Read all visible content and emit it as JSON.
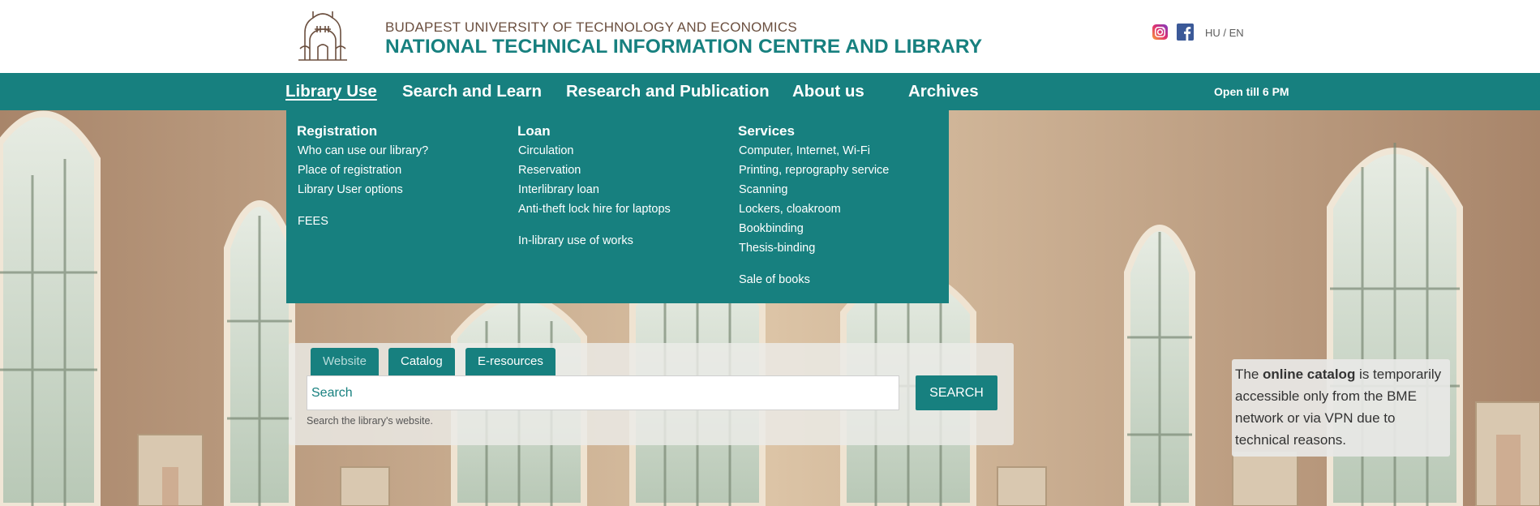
{
  "header": {
    "university": "BUDAPEST UNIVERSITY OF TECHNOLOGY AND ECONOMICS",
    "library": "NATIONAL TECHNICAL INFORMATION CENTRE AND LIBRARY",
    "social": [
      "instagram-icon",
      "facebook-icon"
    ],
    "lang": "HU / EN"
  },
  "nav": {
    "items": [
      {
        "label": "Library Use",
        "active": true
      },
      {
        "label": "Search and Learn"
      },
      {
        "label": "Research and Publication"
      },
      {
        "label": "About us"
      },
      {
        "label": "Archives"
      }
    ],
    "open_hours": "Open till 6 PM"
  },
  "mega_menu": {
    "columns": [
      {
        "heading": "Registration",
        "links": [
          "Who can use our library?",
          "Place of registration",
          "Library User options"
        ],
        "extra": [
          "FEES"
        ]
      },
      {
        "heading": "Loan",
        "links": [
          "Circulation",
          "Reservation",
          "Interlibrary loan",
          "Anti-theft lock hire for laptops"
        ],
        "extra": [
          "In-library use of works"
        ]
      },
      {
        "heading": "Services",
        "links": [
          "Computer, Internet, Wi-Fi",
          "Printing, reprography service",
          "Scanning",
          "Lockers, cloakroom",
          "Bookbinding",
          "Thesis-binding"
        ],
        "extra": [
          "Sale of books"
        ]
      }
    ]
  },
  "search": {
    "tabs": [
      "Website",
      "Catalog",
      "E-resources"
    ],
    "active_tab": "Website",
    "placeholder": "Search",
    "button": "SEARCH",
    "hint": "Search the library's website."
  },
  "notice": {
    "prefix": "The ",
    "bold": "online catalog",
    "suffix": " is temporarily accessible only from the BME network or via VPN due to technical reasons."
  },
  "colors": {
    "accent": "#17807f",
    "brown": "#6b4f3f"
  }
}
